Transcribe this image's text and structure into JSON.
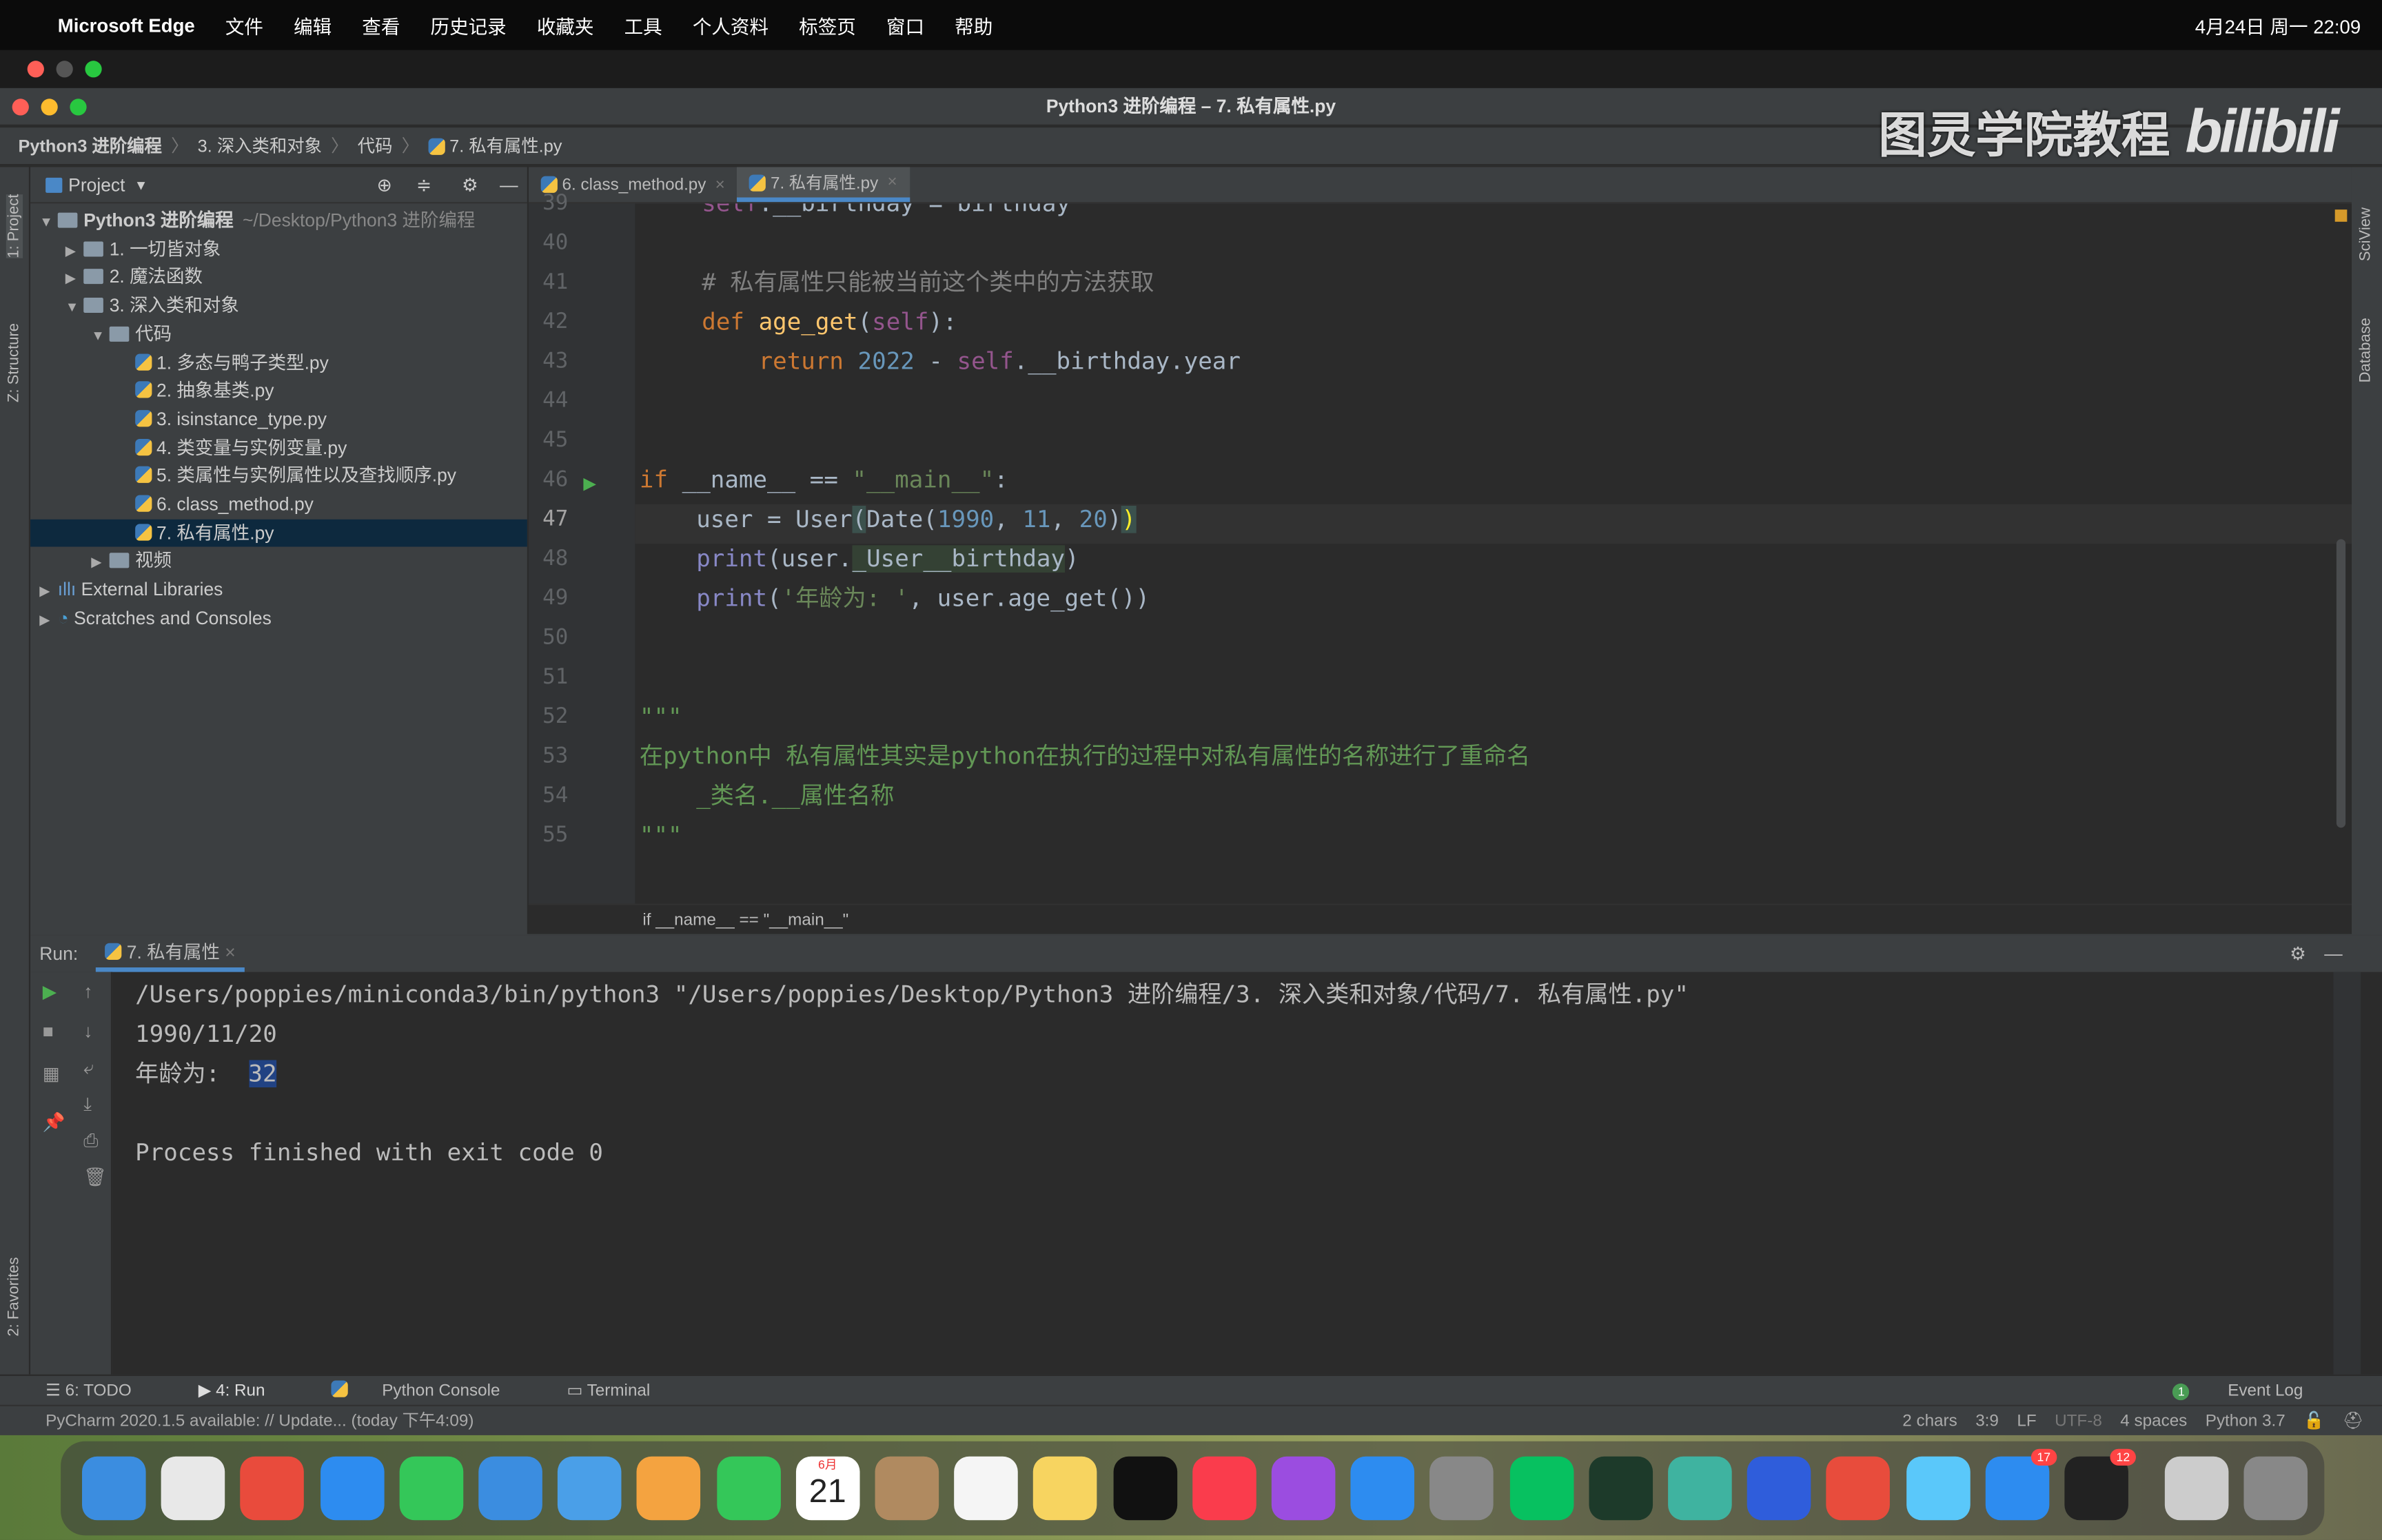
{
  "menubar": {
    "app": "Microsoft Edge",
    "items": [
      "文件",
      "编辑",
      "查看",
      "历史记录",
      "收藏夹",
      "工具",
      "个人资料",
      "标签页",
      "窗口",
      "帮助"
    ],
    "clock": "4月24日 周一 22:09"
  },
  "window": {
    "title": "Python3 进阶编程 – 7. 私有属性.py"
  },
  "breadcrumb": [
    "Python3 进阶编程",
    "3. 深入类和对象",
    "代码",
    "7. 私有属性.py"
  ],
  "watermark": {
    "text": "图灵学院教程",
    "logo": "bilibili"
  },
  "left_stripe": {
    "project": "1: Project",
    "structure": "Z: Structure",
    "favorites": "2: Favorites"
  },
  "right_stripe": {
    "sciview": "SciView",
    "database": "Database"
  },
  "project": {
    "title": "Project",
    "tree": [
      {
        "label": "Python3 进阶编程",
        "hint": "~/Desktop/Python3 进阶编程",
        "depth": 0,
        "type": "folder",
        "open": true
      },
      {
        "label": "1. 一切皆对象",
        "depth": 1,
        "type": "folder",
        "open": false
      },
      {
        "label": "2. 魔法函数",
        "depth": 1,
        "type": "folder",
        "open": false
      },
      {
        "label": "3. 深入类和对象",
        "depth": 1,
        "type": "folder",
        "open": true
      },
      {
        "label": "代码",
        "depth": 2,
        "type": "folder",
        "open": true
      },
      {
        "label": "1. 多态与鸭子类型.py",
        "depth": 3,
        "type": "py"
      },
      {
        "label": "2. 抽象基类.py",
        "depth": 3,
        "type": "py"
      },
      {
        "label": "3. isinstance_type.py",
        "depth": 3,
        "type": "py"
      },
      {
        "label": "4. 类变量与实例变量.py",
        "depth": 3,
        "type": "py"
      },
      {
        "label": "5. 类属性与实例属性以及查找顺序.py",
        "depth": 3,
        "type": "py"
      },
      {
        "label": "6. class_method.py",
        "depth": 3,
        "type": "py"
      },
      {
        "label": "7. 私有属性.py",
        "depth": 3,
        "type": "py",
        "selected": true
      },
      {
        "label": "视频",
        "depth": 2,
        "type": "folder",
        "open": false
      },
      {
        "label": "External Libraries",
        "depth": 0,
        "type": "lib",
        "open": false
      },
      {
        "label": "Scratches and Consoles",
        "depth": 0,
        "type": "scratch",
        "open": false
      }
    ]
  },
  "editor": {
    "tabs": [
      {
        "label": "6. class_method.py",
        "active": false
      },
      {
        "label": "7. 私有属性.py",
        "active": true
      }
    ],
    "line_numbers": [
      "39",
      "40",
      "41",
      "42",
      "43",
      "44",
      "45",
      "46",
      "47",
      "48",
      "49",
      "50",
      "51",
      "52",
      "53",
      "54",
      "55"
    ],
    "current_line": "47",
    "footer_breadcrumb": "if __name__ == \"__main__\""
  },
  "run": {
    "label": "Run:",
    "tab": "7. 私有属性",
    "output": [
      "/Users/poppies/miniconda3/bin/python3 \"/Users/poppies/Desktop/Python3 进阶编程/3. 深入类和对象/代码/7. 私有属性.py\"",
      "1990/11/20",
      "年龄为:  ",
      "32",
      "",
      "Process finished with exit code 0"
    ]
  },
  "tooltabs": [
    "6: TODO",
    "4: Run",
    "Python Console",
    "Terminal"
  ],
  "event_log": {
    "count": "1",
    "label": "Event Log"
  },
  "status": {
    "message": "PyCharm 2020.1.5 available: // Update... (today 下午4:09)",
    "chars": "2 chars",
    "pos": "3:9",
    "eol": "LF",
    "enc": "UTF-8",
    "indent": "4 spaces",
    "interp": "Python 3.7"
  },
  "dock": {
    "calendar_month": "6月",
    "calendar_day": "21",
    "badges": [
      "17",
      "12"
    ]
  },
  "colors": {
    "keyword": "#cc7832",
    "self": "#94558d",
    "number": "#6897bb",
    "string": "#6a8759",
    "selection": "#0d293e",
    "accent": "#4a88c7"
  }
}
